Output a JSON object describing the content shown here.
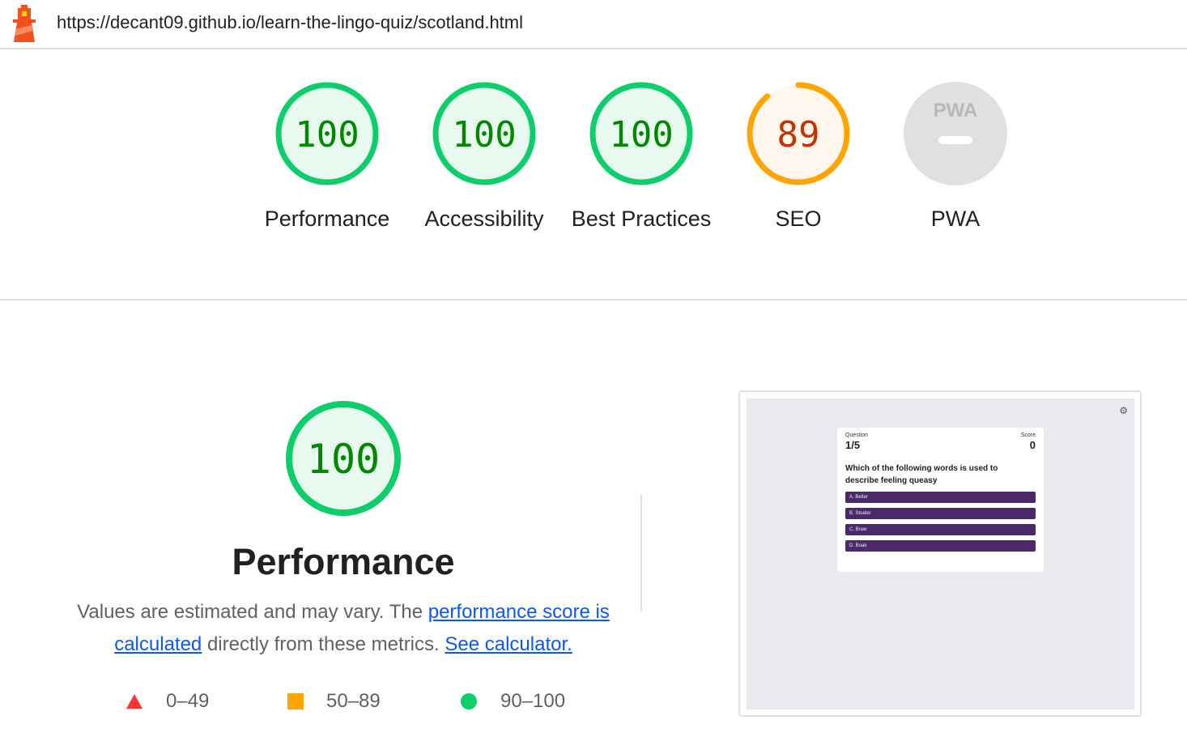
{
  "url": "https://decant09.github.io/learn-the-lingo-quiz/scotland.html",
  "colors": {
    "pass": "#0cce6b",
    "pass_text": "#008800",
    "pass_fill": "#e8faef",
    "average": "#ffa400",
    "average_text": "#c33300",
    "average_fill": "#fff7ed",
    "fail": "#ff3333",
    "na": "#e0e0e0"
  },
  "gauges": [
    {
      "label": "Performance",
      "score": "100",
      "value": 100,
      "status": "pass"
    },
    {
      "label": "Accessibility",
      "score": "100",
      "value": 100,
      "status": "pass"
    },
    {
      "label": "Best Practices",
      "score": "100",
      "value": 100,
      "status": "pass"
    },
    {
      "label": "SEO",
      "score": "89",
      "value": 89,
      "status": "average"
    },
    {
      "label": "PWA",
      "score": "",
      "status": "na",
      "icon": "pwa-logo"
    }
  ],
  "performance": {
    "score": "100",
    "title": "Performance",
    "desc_before": "Values are estimated and may vary. The ",
    "link1": "performance score is calculated",
    "desc_middle": " directly from these metrics. ",
    "link2": "See calculator."
  },
  "legend": [
    {
      "range": "0–49",
      "shape": "triangle"
    },
    {
      "range": "50–89",
      "shape": "square"
    },
    {
      "range": "90–100",
      "shape": "circle"
    }
  ],
  "screenshot": {
    "question_label": "Question",
    "question_value": "1/5",
    "score_label": "Score",
    "score_value": "0",
    "question": "Which of the following words is used to describe feeling queasy",
    "options": [
      "A. Belter",
      "B. Stoater",
      "C. Braw",
      "D. Boak"
    ]
  }
}
